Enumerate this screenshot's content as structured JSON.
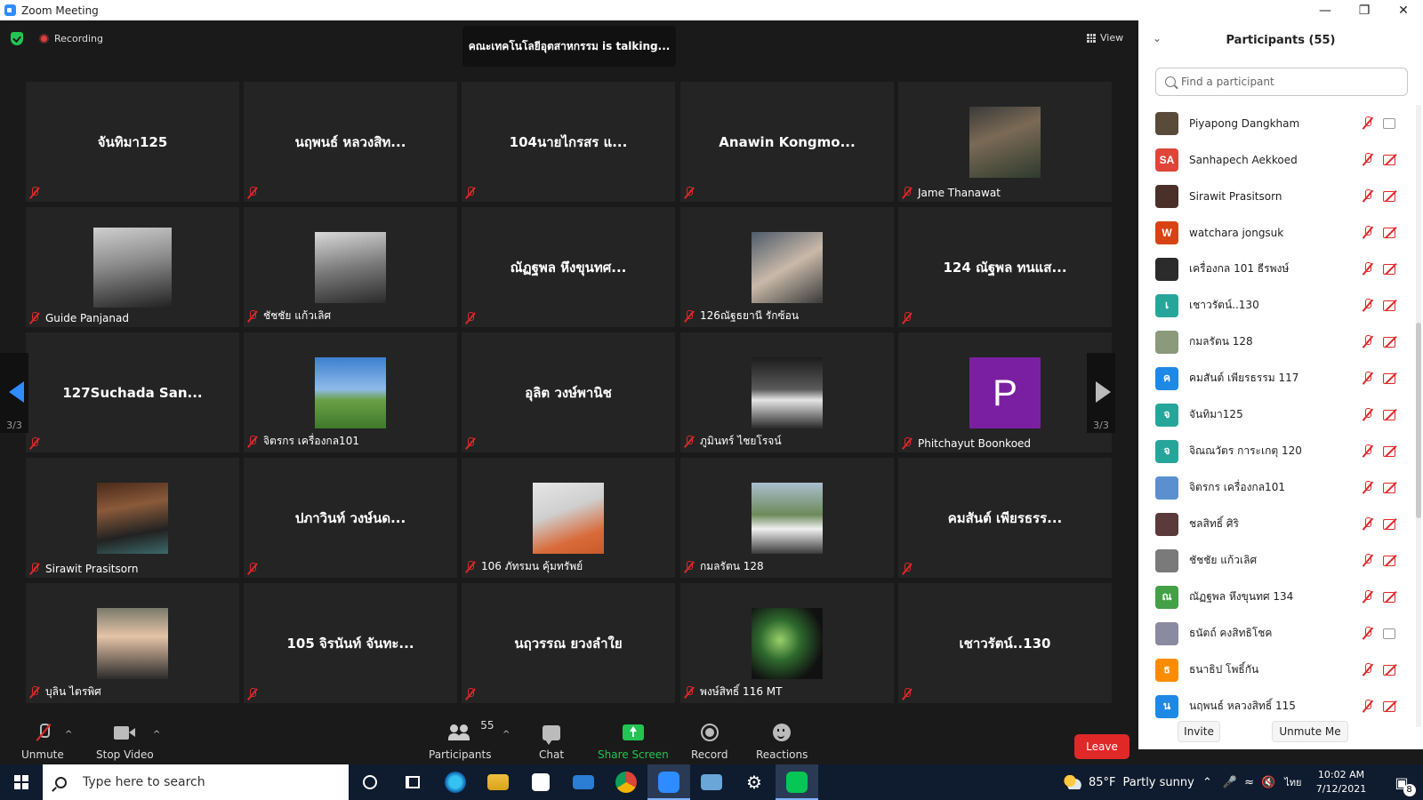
{
  "window": {
    "title": "Zoom Meeting"
  },
  "meeting": {
    "recording_label": "Recording",
    "talking": "คณะเทคโนโลยีอุตสาหกรรม is talking...",
    "view_label": "View",
    "page_left": "3/3",
    "page_right": "3/3"
  },
  "tiles": [
    {
      "big": "จันทิมา125",
      "label": ""
    },
    {
      "big": "นฤพนธ์ หลวงสิท...",
      "label": ""
    },
    {
      "big": "104นายไกรสร แ...",
      "label": ""
    },
    {
      "big": "Anawin Kongmo...",
      "label": ""
    },
    {
      "big": "",
      "label": "Jame Thanawat"
    },
    {
      "big": "",
      "label": "Guide Panjanad"
    },
    {
      "big": "",
      "label": "ชัชชัย แก้วเลิศ"
    },
    {
      "big": "ณัฏฐพล หึงขุนทศ...",
      "label": ""
    },
    {
      "big": "",
      "label": "126ณัฐธยานี รักซ้อน"
    },
    {
      "big": "124 ณัฐพล ทนแส...",
      "label": ""
    },
    {
      "big": "127Suchada San...",
      "label": ""
    },
    {
      "big": "",
      "label": "จิตรกร เครื่องกล101"
    },
    {
      "big": "อุลิต วงษ์พานิช",
      "label": ""
    },
    {
      "big": "",
      "label": "ภูมินทร์ ไชยโรจน์"
    },
    {
      "big": "",
      "label": "Phitchayut Boonkoed",
      "avatar_letter": "P"
    },
    {
      "big": "",
      "label": "Sirawit Prasitsorn"
    },
    {
      "big": "ปภาวินท์ วงษ์นด...",
      "label": ""
    },
    {
      "big": "",
      "label": "106 ภัทรมน คุ้มทรัพย์"
    },
    {
      "big": "",
      "label": "กมลรัตน 128"
    },
    {
      "big": "คมสันต์ เพียรธรร...",
      "label": ""
    },
    {
      "big": "",
      "label": "บุลิน ไตรพิศ"
    },
    {
      "big": "105 จิรนันท์ จันทะ...",
      "label": ""
    },
    {
      "big": "นฤวรรณ ยวงลำใย",
      "label": ""
    },
    {
      "big": "",
      "label": "พงษ์สิทธิ์ 116 MT"
    },
    {
      "big": "เชาวรัตน์..130",
      "label": ""
    }
  ],
  "toolbar": {
    "unmute": "Unmute",
    "stop_video": "Stop Video",
    "participants": "Participants",
    "participants_count": "55",
    "chat": "Chat",
    "share_screen": "Share Screen",
    "record": "Record",
    "reactions": "Reactions",
    "leave": "Leave"
  },
  "panel": {
    "title": "Participants (55)",
    "search_placeholder": "Find a participant",
    "invite": "Invite",
    "unmute_me": "Unmute Me",
    "participants": [
      {
        "initials": "",
        "name": "Piyapong Dangkham",
        "color": "#5a4a3a",
        "cam_on": true
      },
      {
        "initials": "SA",
        "name": "Sanhapech Aekkoed",
        "color": "#e0453a",
        "cam_on": false
      },
      {
        "initials": "",
        "name": "Sirawit Prasitsorn",
        "color": "#4a3028",
        "cam_on": false
      },
      {
        "initials": "W",
        "name": "watchara jongsuk",
        "color": "#d84315",
        "cam_on": false
      },
      {
        "initials": "",
        "name": "เครื่องกล 101 ธีรพงษ์",
        "color": "#2b2b2b",
        "cam_on": false
      },
      {
        "initials": "เ",
        "name": "เชาวรัตน์..130",
        "color": "#26a69a",
        "cam_on": false
      },
      {
        "initials": "",
        "name": "กมลรัตน 128",
        "color": "#8a9a7a",
        "cam_on": false
      },
      {
        "initials": "ค",
        "name": "คมสันต์ เพียรธรรม 117",
        "color": "#1e88e5",
        "cam_on": false
      },
      {
        "initials": "จ",
        "name": "จันทิมา125",
        "color": "#26a69a",
        "cam_on": false
      },
      {
        "initials": "จ",
        "name": "จิณณวัตร การะเกตุ 120",
        "color": "#26a69a",
        "cam_on": false
      },
      {
        "initials": "",
        "name": "จิตรกร เครื่องกล101",
        "color": "#5b8fd0",
        "cam_on": false
      },
      {
        "initials": "",
        "name": "ชลสิทธิ์ ศิริ",
        "color": "#5a3a3a",
        "cam_on": false
      },
      {
        "initials": "",
        "name": "ชัชชัย แก้วเลิศ",
        "color": "#7a7a7a",
        "cam_on": false
      },
      {
        "initials": "ณ",
        "name": "ณัฏฐพล หึงขุนทศ 134",
        "color": "#43a047",
        "cam_on": false
      },
      {
        "initials": "",
        "name": "ธนัตถ์ คงสิทธิโชค",
        "color": "#8a8aa0",
        "cam_on": true
      },
      {
        "initials": "ธ",
        "name": "ธนาธิป โพธิ์กัน",
        "color": "#fb8c00",
        "cam_on": false
      },
      {
        "initials": "น",
        "name": "นฤพนธ์ หลวงสิทธิ์ 115",
        "color": "#1e88e5",
        "cam_on": false
      }
    ]
  },
  "taskbar": {
    "search_placeholder": "Type here to search",
    "weather_temp": "85°F",
    "weather_text": "Partly sunny",
    "lang": "ไทย",
    "time": "10:02 AM",
    "date": "7/12/2021",
    "notif_count": "8"
  },
  "colors": {
    "accent_blue": "#2d8cff",
    "share_green": "#23c552",
    "leave_red": "#e02828",
    "taskbar_bg": "#0f1b2e"
  }
}
